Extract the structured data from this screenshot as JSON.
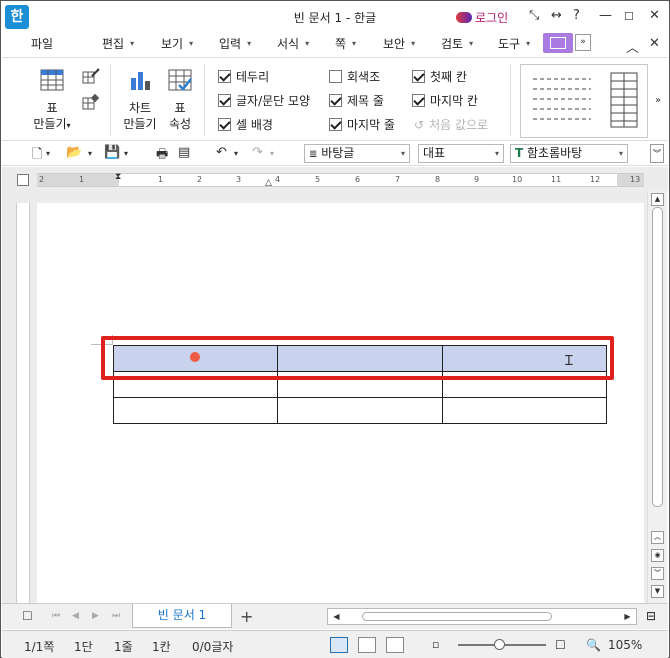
{
  "window": {
    "app_icon": "한",
    "title": "빈 문서 1 - 한글",
    "login": "로그인",
    "controls": [
      "resize-icon",
      "split-icon",
      "help-icon",
      "minimize-icon",
      "maximize-icon",
      "close-icon"
    ]
  },
  "menu": {
    "file": "파일",
    "items": [
      "편집",
      "보기",
      "입력",
      "서식",
      "쪽",
      "보안",
      "검토",
      "도구"
    ],
    "more": "»"
  },
  "ribbon": {
    "table_make": {
      "line1": "표",
      "line2": "만들기"
    },
    "chart_make": {
      "line1": "차트",
      "line2": "만들기"
    },
    "table_props": {
      "line1": "표",
      "line2": "속성"
    },
    "checks_col1": [
      {
        "label": "테두리",
        "checked": true
      },
      {
        "label": "글자/문단 모양",
        "checked": true
      },
      {
        "label": "셀 배경",
        "checked": true
      }
    ],
    "checks_col2": [
      {
        "label": "회색조",
        "checked": false
      },
      {
        "label": "제목 줄",
        "checked": true
      },
      {
        "label": "마지막 줄",
        "checked": true
      }
    ],
    "checks_col3": [
      {
        "label": "첫째 칸",
        "checked": true
      },
      {
        "label": "마지막 칸",
        "checked": true
      }
    ],
    "reset_label": "처음 값으로",
    "gallery_more": "»"
  },
  "toolbar": {
    "style_combo": "바탕글",
    "lang_combo": "대표",
    "font_combo": "함초롬바탕"
  },
  "ruler": {
    "numbers": [
      "2",
      "1",
      "1",
      "2",
      "3",
      "4",
      "5",
      "6",
      "7",
      "8",
      "9",
      "10",
      "11",
      "12",
      "13"
    ]
  },
  "tabs": {
    "doc_tab": "빈 문서 1",
    "add": "+"
  },
  "status": {
    "page": "1/1쪽",
    "section": "1단",
    "line": "1줄",
    "column": "1칸",
    "chars": "0/0글자",
    "zoom": "105%",
    "zoom_slider_fraction": 0.41
  },
  "document": {
    "table": {
      "rows": 3,
      "cols": 3,
      "selected_row": 0
    }
  },
  "colors": {
    "accent": "#1a8fd6",
    "selection": "#c9d3ee",
    "highlight": "#e0201c",
    "active_tab": "#a97ae0"
  }
}
